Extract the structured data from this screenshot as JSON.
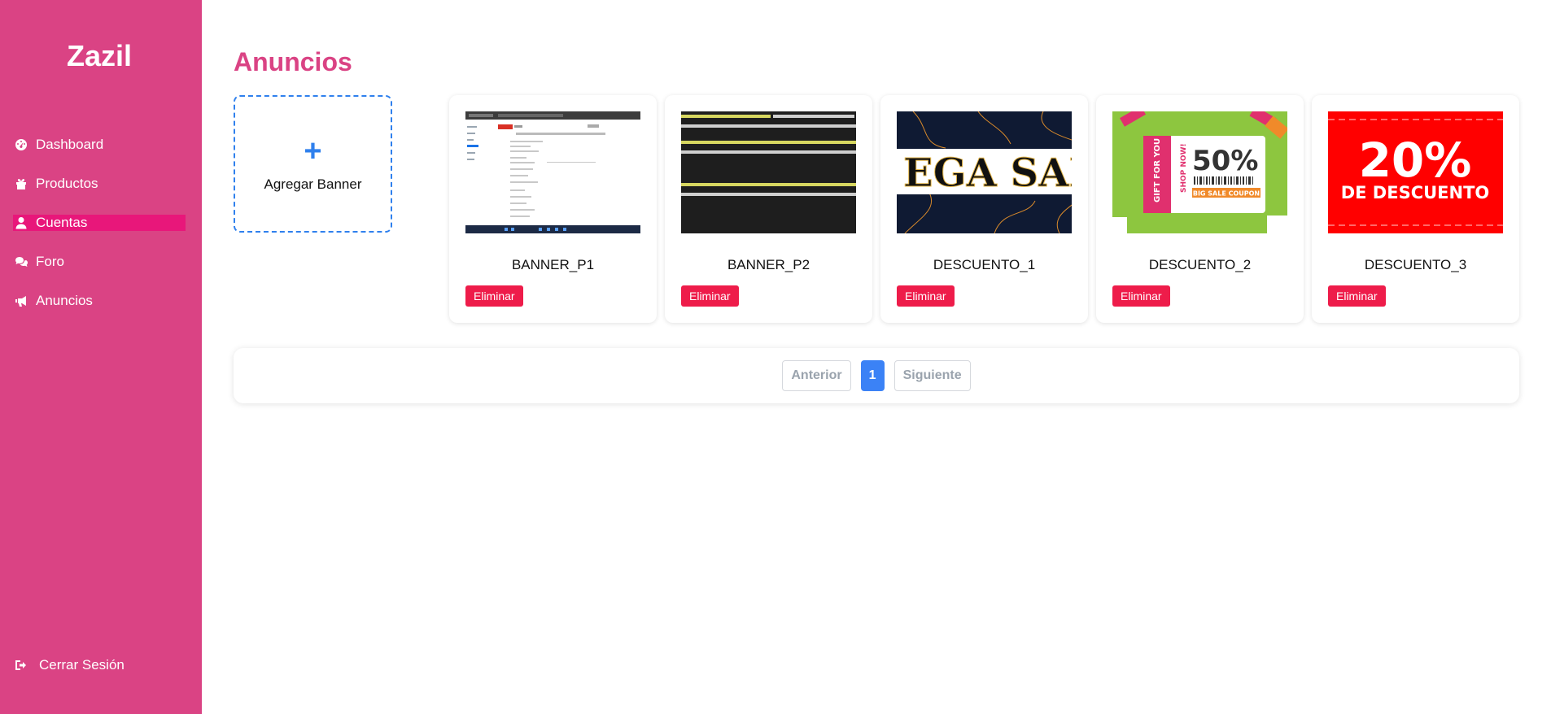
{
  "app": {
    "brand": "Zazil"
  },
  "sidebar": {
    "items": [
      {
        "label": "Dashboard",
        "icon": "dashboard-gauge-icon"
      },
      {
        "label": "Productos",
        "icon": "gift-icon"
      },
      {
        "label": "Cuentas",
        "icon": "user-icon",
        "active": true
      },
      {
        "label": "Foro",
        "icon": "comments-icon"
      },
      {
        "label": "Anuncios",
        "icon": "megaphone-icon"
      }
    ],
    "logout": {
      "label": "Cerrar Sesión",
      "icon": "sign-out-icon"
    }
  },
  "main": {
    "title": "Anuncios",
    "add_banner": {
      "plus": "+",
      "label": "Agregar Banner"
    },
    "banners": [
      {
        "name": "BANNER_P1",
        "delete_label": "Eliminar",
        "thumb": "screenshot of browser page"
      },
      {
        "name": "BANNER_P2",
        "delete_label": "Eliminar",
        "thumb": "terminal output"
      },
      {
        "name": "DESCUENTO_1",
        "delete_label": "Eliminar",
        "thumb_text": "EGA SAI"
      },
      {
        "name": "DESCUENTO_2",
        "delete_label": "Eliminar",
        "thumb_text": {
          "percent": "50%",
          "side": "GIFT FOR YOU",
          "shop": "SHOP NOW!",
          "coupon": "BIG SALE COUPON"
        }
      },
      {
        "name": "DESCUENTO_3",
        "delete_label": "Eliminar",
        "thumb_text": {
          "big": "20%",
          "small": "DE DESCUENTO"
        }
      }
    ],
    "pagination": {
      "prev": "Anterior",
      "page": "1",
      "next": "Siguiente"
    }
  },
  "colors": {
    "sidebar": "#da4384",
    "active": "#e8177a",
    "accent_blue": "#3b82f6",
    "danger": "#ee1c4a"
  }
}
